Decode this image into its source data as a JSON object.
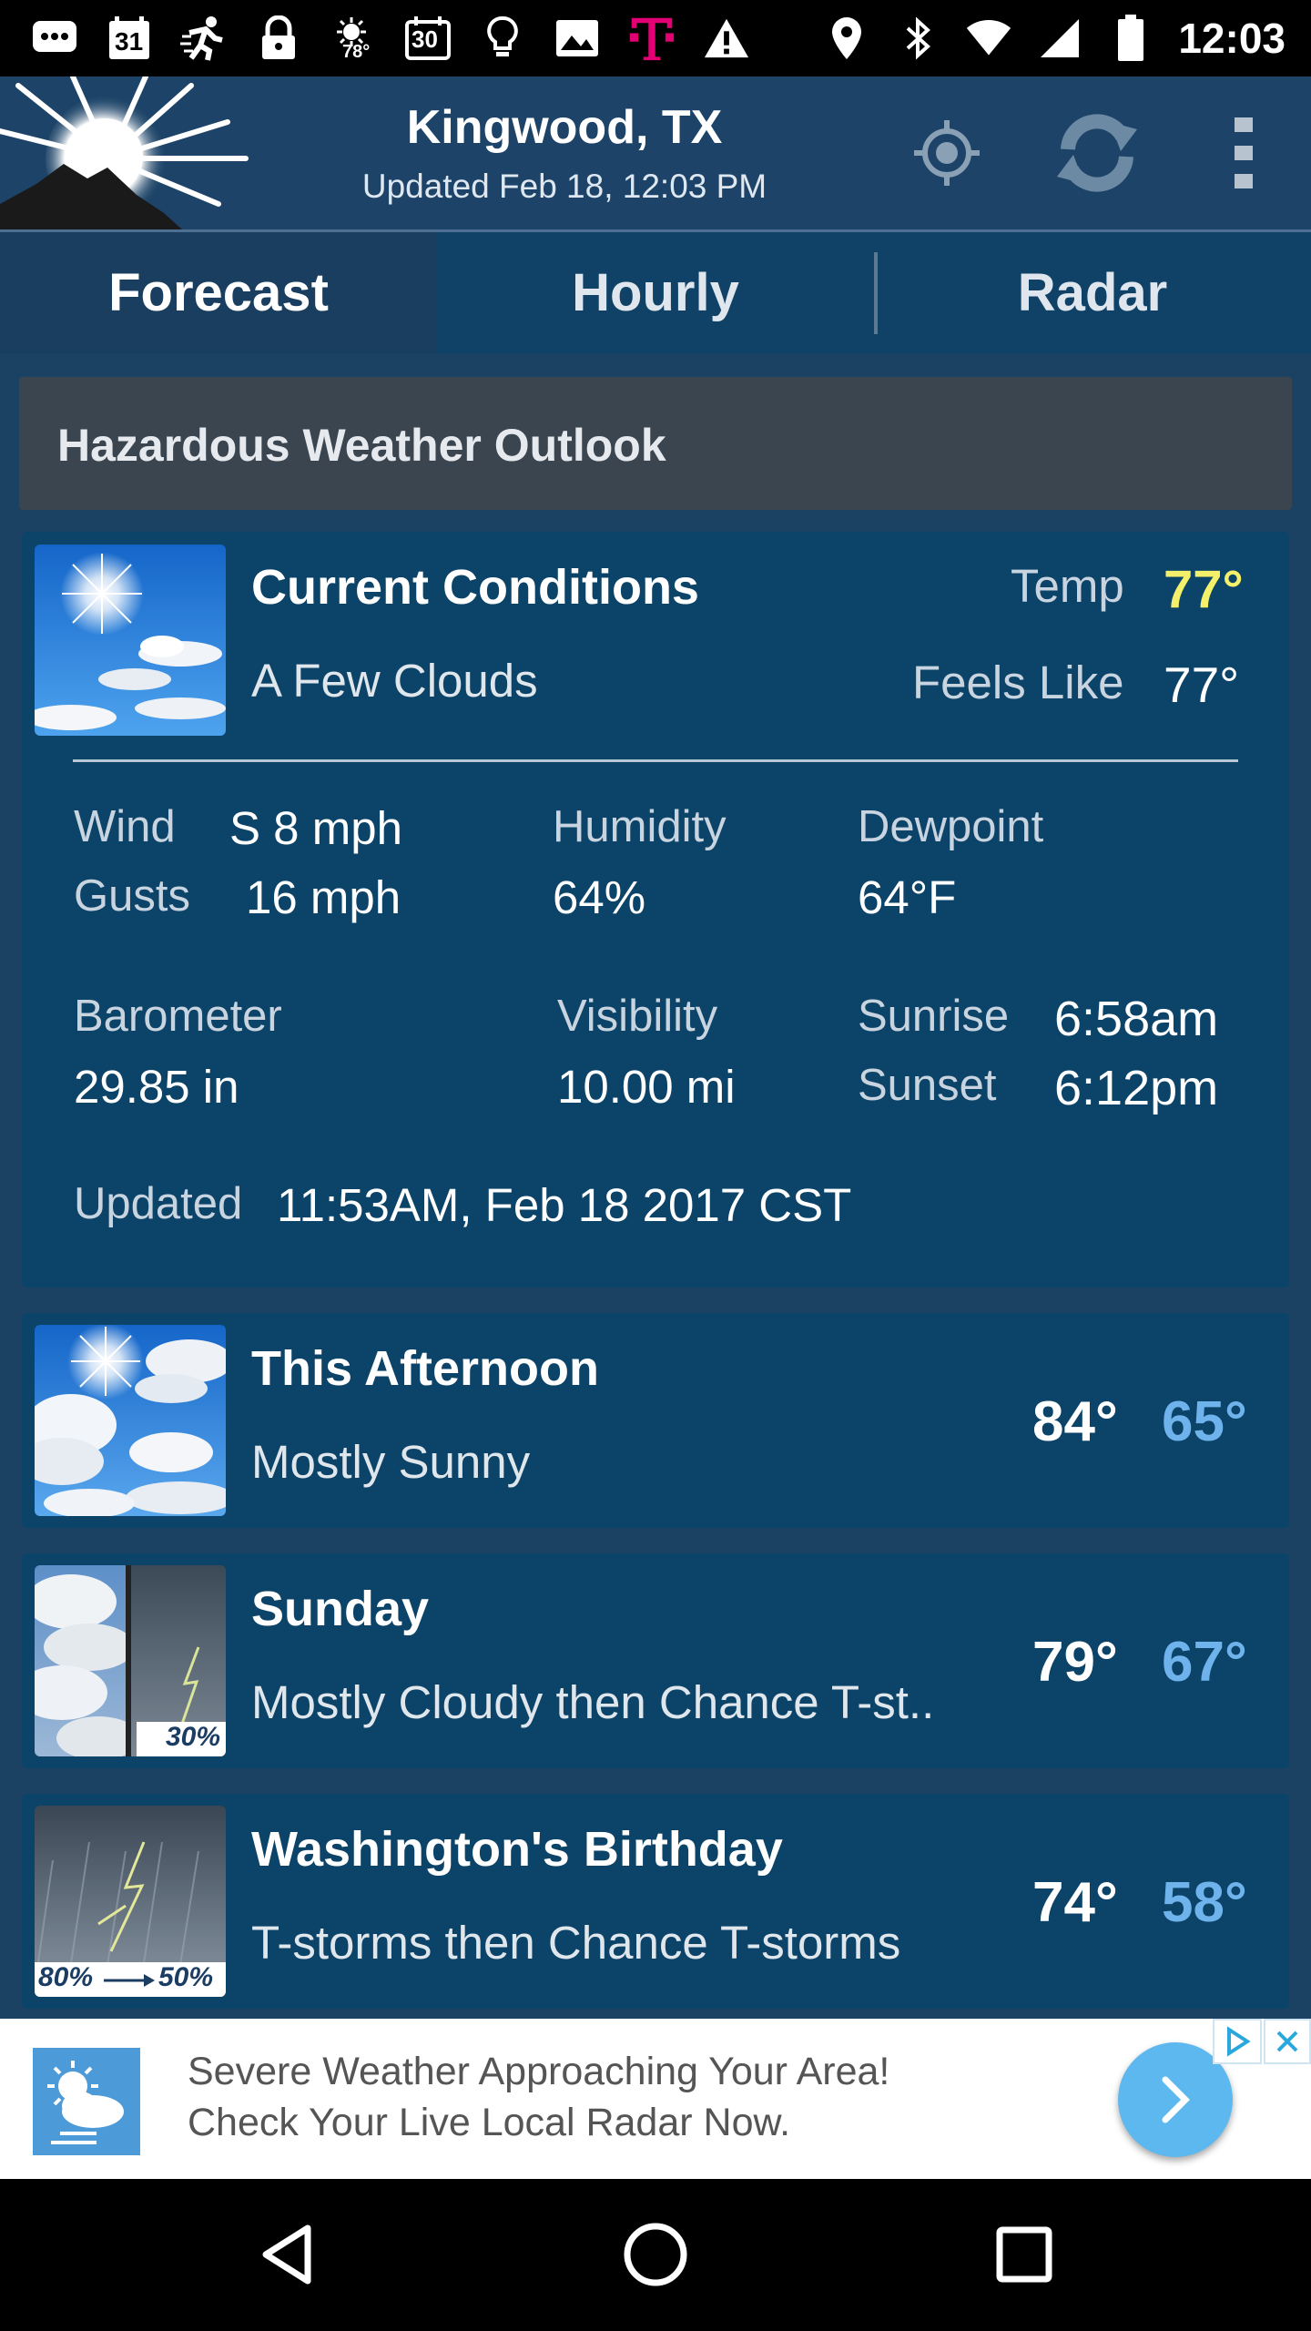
{
  "status_bar": {
    "time": "12:03",
    "calendar_day": "31",
    "temp_badge": "78°",
    "thirty_badge": "30",
    "left_icons": [
      "message-icon",
      "calendar-icon",
      "fitness-icon",
      "lock-icon",
      "weather-icon",
      "thirty-icon",
      "bulb-icon",
      "image-icon",
      "tmobile-icon",
      "warning-icon"
    ],
    "right_icons": [
      "location-icon",
      "bluetooth-icon",
      "wifi-icon",
      "signal-icon",
      "battery-icon"
    ]
  },
  "header": {
    "location": "Kingwood, TX",
    "updated": "Updated Feb 18, 12:03 PM"
  },
  "tabs": [
    {
      "label": "Forecast",
      "active": true
    },
    {
      "label": "Hourly",
      "active": false
    },
    {
      "label": "Radar",
      "active": false
    }
  ],
  "hazard": {
    "label": "Hazardous Weather Outlook"
  },
  "current": {
    "title": "Current Conditions",
    "condition": "A Few Clouds",
    "temp_label": "Temp",
    "temp_value": "77°",
    "feels_label": "Feels Like",
    "feels_value": "77°",
    "wind_label": "Wind",
    "wind_value": "S 8 mph",
    "gusts_label": "Gusts",
    "gusts_value": "16 mph",
    "humidity_label": "Humidity",
    "humidity_value": "64%",
    "dewpoint_label": "Dewpoint",
    "dewpoint_value": "64°F",
    "barometer_label": "Barometer",
    "barometer_value": "29.85 in",
    "visibility_label": "Visibility",
    "visibility_value": "10.00 mi",
    "sunrise_label": "Sunrise",
    "sunrise_value": "6:58am",
    "sunset_label": "Sunset",
    "sunset_value": "6:12pm",
    "updated_label": "Updated",
    "updated_value": "11:53AM, Feb 18 2017 CST"
  },
  "forecast": [
    {
      "title": "This Afternoon",
      "condition": "Mostly Sunny",
      "high": "84°",
      "low": "65°"
    },
    {
      "title": "Sunday",
      "condition": "Mostly Cloudy then Chance T-st..",
      "high": "79°",
      "low": "67°",
      "precip": "30%"
    },
    {
      "title": "Washington's Birthday",
      "condition": "T-storms then Chance T-storms",
      "high": "74°",
      "low": "58°",
      "precip_from": "80%",
      "precip_to": "50%"
    }
  ],
  "ad": {
    "line1": "Severe Weather Approaching Your Area!",
    "line2": "Check Your Live Local Radar Now."
  },
  "colors": {
    "temp_highlight": "#f5f06a",
    "low_temp": "#6fb3ec",
    "card_bg": "#0c4368"
  }
}
